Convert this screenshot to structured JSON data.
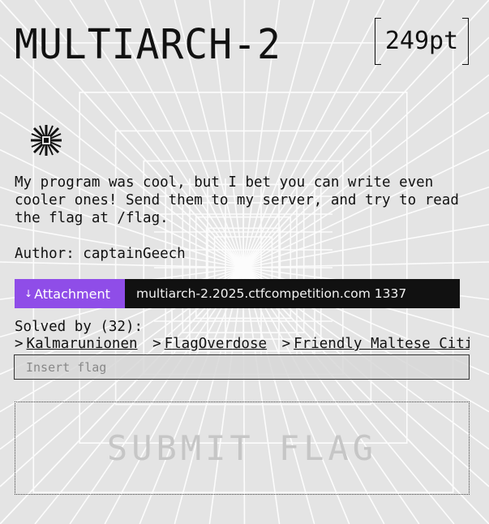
{
  "challenge": {
    "title": "MULTIARCH-2",
    "points": "249pt",
    "description": "My program was cool, but I bet you can write even\ncooler ones! Send them to my server, and try to read\nthe flag at /flag.",
    "author": "Author: captainGeech"
  },
  "attachment": {
    "icon": "download-icon",
    "icon_glyph": "↓",
    "label": "Attachment",
    "connection": "multiarch-2.2025.ctfcompetition.com 1337"
  },
  "solves": {
    "label": "Solved by (32):",
    "separator": ">",
    "teams": [
      "Kalmarunionen",
      "FlagOverdose",
      "Friendly Maltese Citiz"
    ]
  },
  "flag_form": {
    "placeholder": "Insert flag",
    "value": "",
    "submit_label": "SUBMIT FLAG"
  },
  "colors": {
    "accent": "#8f4de8",
    "connection_bg": "#111111",
    "background": "#e6e6e6",
    "grid": "#ffffff"
  },
  "icons": {
    "emblem": "asterisk-burst-icon"
  }
}
